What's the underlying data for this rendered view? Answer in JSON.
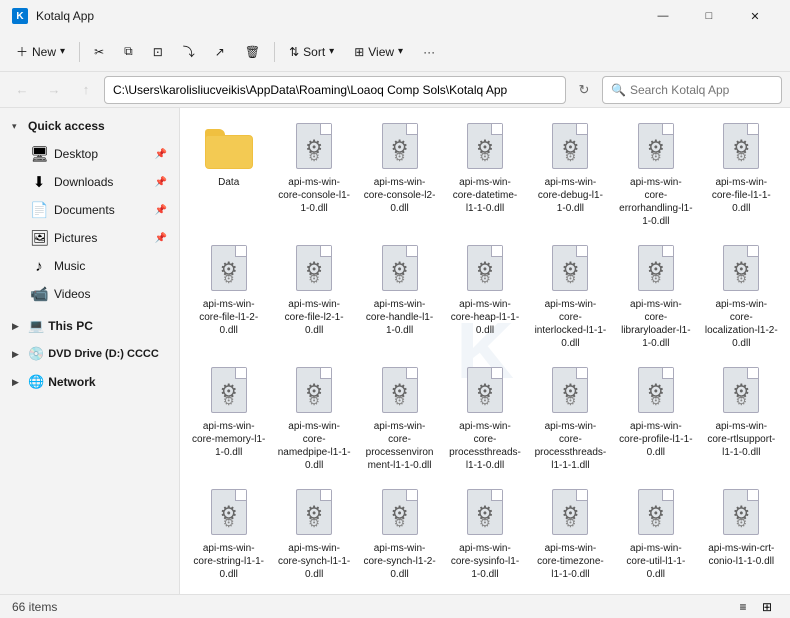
{
  "titleBar": {
    "appName": "Kotalq App",
    "icon": "K",
    "controls": {
      "minimize": "—",
      "maximize": "□",
      "close": "✕"
    }
  },
  "toolbar": {
    "newLabel": "New",
    "newArrow": "▾",
    "cutLabel": "✂",
    "copyLabel": "⧉",
    "pasteLabel": "⊡",
    "renameLabel": "⤵",
    "shareLabel": "↗",
    "deleteLabel": "🗑",
    "sortLabel": "Sort",
    "sortArrow": "▾",
    "viewLabel": "View",
    "viewArrow": "▾",
    "moreLabel": "···"
  },
  "addressBar": {
    "backArrow": "←",
    "forwardArrow": "→",
    "upArrow": "↑",
    "path": "C:\\Users\\karolisliucveikis\\AppData\\Roaming\\Loaoq Comp Sols\\Kotalq App",
    "refreshArrow": "→",
    "searchPlaceholder": "Search Kotalq App"
  },
  "sidebar": {
    "quickAccessLabel": "Quick access",
    "items": [
      {
        "id": "desktop",
        "label": "Desktop",
        "icon": "🖥",
        "pinned": true
      },
      {
        "id": "downloads",
        "label": "Downloads",
        "icon": "⬇",
        "pinned": true
      },
      {
        "id": "documents",
        "label": "Documents",
        "icon": "📄",
        "pinned": true
      },
      {
        "id": "pictures",
        "label": "Pictures",
        "icon": "🖼",
        "pinned": true
      },
      {
        "id": "music",
        "label": "Music",
        "icon": "♪"
      },
      {
        "id": "videos",
        "label": "Videos",
        "icon": "📹"
      }
    ],
    "thisPC": "This PC",
    "dvdDrive": "DVD Drive (D:) CCCC",
    "network": "Network"
  },
  "files": [
    {
      "id": "data-folder",
      "name": "Data",
      "type": "folder"
    },
    {
      "id": "f1",
      "name": "api-ms-win-core-console-l1-1-0.dll",
      "type": "dll"
    },
    {
      "id": "f2",
      "name": "api-ms-win-core-console-l2-0.dll",
      "type": "dll"
    },
    {
      "id": "f3",
      "name": "api-ms-win-core-datetime-l1-1-0.dll",
      "type": "dll"
    },
    {
      "id": "f4",
      "name": "api-ms-win-core-debug-l1-1-0.dll",
      "type": "dll"
    },
    {
      "id": "f5",
      "name": "api-ms-win-core-errorhandling-l1-1-0.dll",
      "type": "dll"
    },
    {
      "id": "f6",
      "name": "api-ms-win-core-file-l1-1-0.dll",
      "type": "dll"
    },
    {
      "id": "f7",
      "name": "api-ms-win-core-file-l1-2-0.dll",
      "type": "dll"
    },
    {
      "id": "f8",
      "name": "api-ms-win-core-file-l2-1-0.dll",
      "type": "dll"
    },
    {
      "id": "f9",
      "name": "api-ms-win-core-handle-l1-1-0.dll",
      "type": "dll"
    },
    {
      "id": "f10",
      "name": "api-ms-win-core-heap-l1-1-0.dll",
      "type": "dll"
    },
    {
      "id": "f11",
      "name": "api-ms-win-core-interlocked-l1-1-0.dll",
      "type": "dll"
    },
    {
      "id": "f12",
      "name": "api-ms-win-core-libraryloader-l1-1-0.dll",
      "type": "dll"
    },
    {
      "id": "f13",
      "name": "api-ms-win-core-localization-l1-2-0.dll",
      "type": "dll"
    },
    {
      "id": "f14",
      "name": "api-ms-win-core-memory-l1-1-0.dll",
      "type": "dll"
    },
    {
      "id": "f15",
      "name": "api-ms-win-core-namedpipe-l1-1-0.dll",
      "type": "dll"
    },
    {
      "id": "f16",
      "name": "api-ms-win-core-processenvironment-l1-1-0.dll",
      "type": "dll"
    },
    {
      "id": "f17",
      "name": "api-ms-win-core-processthreads-l1-1-0.dll",
      "type": "dll"
    },
    {
      "id": "f18",
      "name": "api-ms-win-core-processthreads-l1-1-1.dll",
      "type": "dll"
    },
    {
      "id": "f19",
      "name": "api-ms-win-core-profile-l1-1-0.dll",
      "type": "dll"
    },
    {
      "id": "f20",
      "name": "api-ms-win-core-rtlsupport-l1-1-0.dll",
      "type": "dll"
    },
    {
      "id": "f21",
      "name": "api-ms-win-core-string-l1-1-0.dll",
      "type": "dll"
    },
    {
      "id": "f22",
      "name": "api-ms-win-core-synch-l1-1-0.dll",
      "type": "dll"
    },
    {
      "id": "f23",
      "name": "api-ms-win-core-synch-l1-2-0.dll",
      "type": "dll"
    },
    {
      "id": "f24",
      "name": "api-ms-win-core-sysinfo-l1-1-0.dll",
      "type": "dll"
    },
    {
      "id": "f25",
      "name": "api-ms-win-core-timezone-l1-1-0.dll",
      "type": "dll"
    },
    {
      "id": "f26",
      "name": "api-ms-win-core-util-l1-1-0.dll",
      "type": "dll"
    },
    {
      "id": "f27",
      "name": "api-ms-win-crt-conio-l1-1-0.dll",
      "type": "dll"
    }
  ],
  "statusBar": {
    "itemCount": "66 items",
    "listViewIcon": "≡",
    "gridViewIcon": "⊞"
  }
}
